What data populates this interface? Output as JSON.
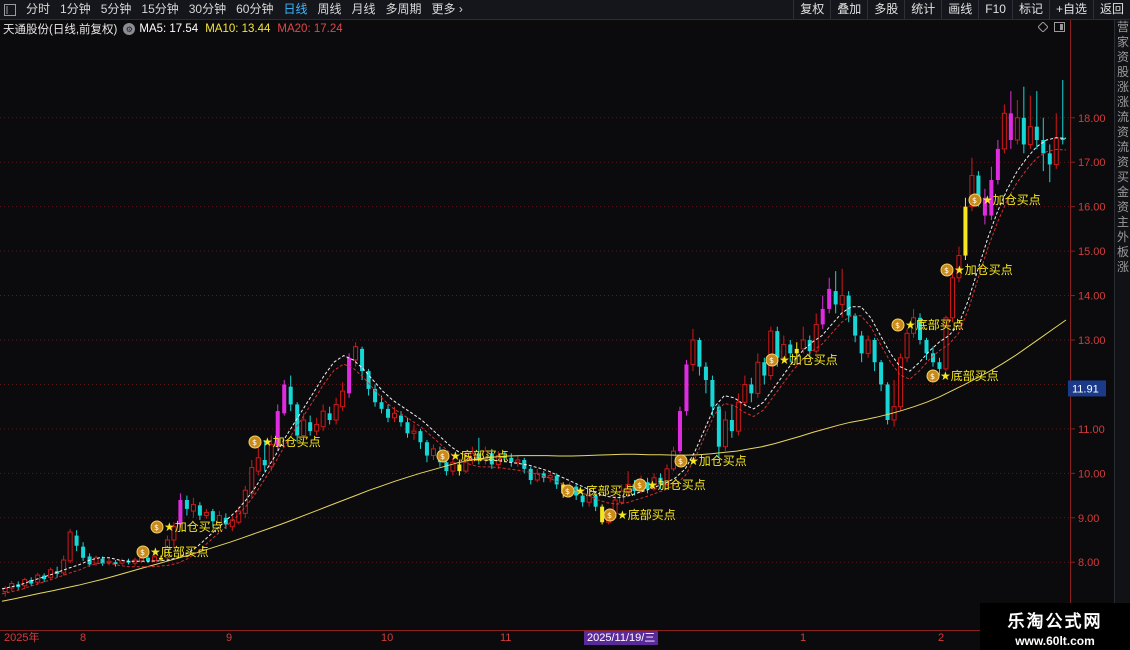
{
  "toolbar": {
    "menu_icon": "menu-icon",
    "periods": [
      "分时",
      "1分钟",
      "5分钟",
      "15分钟",
      "30分钟",
      "60分钟",
      "日线",
      "周线",
      "月线",
      "多周期",
      "更多"
    ],
    "active_period": "日线",
    "more_chevron": "›",
    "right_buttons": [
      "复权",
      "叠加",
      "多股",
      "统计",
      "画线",
      "F10",
      "标记",
      "+自选",
      "返回"
    ]
  },
  "info": {
    "stock": "天通股份(日线,前复权)",
    "ma5": "MA5: 17.54",
    "ma10": "MA10: 13.44",
    "ma20": "MA20: 17.24",
    "colors": {
      "ma5": "#ffffff",
      "ma10": "#f4e63c",
      "ma20": "#e04848"
    }
  },
  "price_axis": {
    "ticks": [
      "18.00",
      "17.00",
      "16.00",
      "15.00",
      "14.00",
      "13.00",
      "12.00",
      "11.00",
      "10.00",
      "9.00",
      "8.00"
    ],
    "current_price": "11.91"
  },
  "date_axis": {
    "labels": [
      "2025年",
      "8",
      "9",
      "10",
      "11",
      "1",
      "2"
    ],
    "cursor_date": "2025/11/19/三"
  },
  "signals": [
    {
      "text": "底部买点"
    },
    {
      "text": "加仓买点"
    },
    {
      "text": "加仓买点"
    },
    {
      "text": "底部买点"
    },
    {
      "text": "底部买点"
    },
    {
      "text": "底部买点"
    },
    {
      "text": "加仓买点"
    },
    {
      "text": "加仓买点"
    },
    {
      "text": "加仓买点"
    },
    {
      "text": "底部买点"
    },
    {
      "text": "底部买点"
    },
    {
      "text": "加仓买点"
    },
    {
      "text": "加仓买点"
    }
  ],
  "right_strip_text": "营家资股涨涨流资流资买金资主外板涨",
  "watermark": {
    "line1": "乐淘公式网",
    "line2": "www.60lt.com"
  },
  "colors": {
    "up": "#d01818",
    "down": "#17d6d6",
    "magenta": "#e02ce0",
    "yellow": "#f5e61e",
    "signal": "#f5e61e",
    "grid": "#5a1a1a",
    "ma_long": "#e6d860",
    "ma_red": "#d03030",
    "ma_white": "#f0f0f0"
  },
  "chart_data": {
    "type": "candlestick",
    "y_range": [
      7.6,
      19.3
    ],
    "candles": [
      [
        7.34,
        7.41,
        7.23,
        7.46
      ],
      [
        7.42,
        7.52,
        7.35,
        7.58
      ],
      [
        7.5,
        7.44,
        7.38,
        7.57
      ],
      [
        7.47,
        7.61,
        7.4,
        7.65
      ],
      [
        7.6,
        7.52,
        7.46,
        7.66
      ],
      [
        7.55,
        7.71,
        7.49,
        7.76
      ],
      [
        7.7,
        7.62,
        7.55,
        7.75
      ],
      [
        7.66,
        7.83,
        7.6,
        7.88
      ],
      [
        7.8,
        7.74,
        7.66,
        7.9
      ],
      [
        7.76,
        8.05,
        7.7,
        8.15
      ],
      [
        8.03,
        8.68,
        7.98,
        8.75
      ],
      [
        8.6,
        8.37,
        8.25,
        8.72
      ],
      [
        8.35,
        8.1,
        8.03,
        8.45
      ],
      [
        8.13,
        7.95,
        7.9,
        8.2
      ],
      [
        7.98,
        8.1,
        7.92,
        8.15
      ],
      [
        8.08,
        7.97,
        7.92,
        8.13
      ],
      [
        7.99,
        8.02,
        7.93,
        8.08
      ],
      [
        8.0,
        7.96,
        7.9,
        8.05
      ],
      [
        7.98,
        8.03,
        7.94,
        8.08
      ],
      [
        8.03,
        7.99,
        7.95,
        8.08
      ],
      [
        7.98,
        8.05,
        7.92,
        8.1
      ],
      [
        8.03,
        8.09,
        7.98,
        8.13
      ],
      [
        8.1,
        8.03,
        7.98,
        8.15
      ],
      [
        8.04,
        8.12,
        8.0,
        8.16
      ],
      [
        8.1,
        8.06,
        8.02,
        8.15
      ],
      [
        8.1,
        8.5,
        8.05,
        8.6
      ],
      [
        8.5,
        8.8,
        8.35,
        8.9
      ],
      [
        8.85,
        9.4,
        8.78,
        9.55
      ],
      [
        9.4,
        9.2,
        9.05,
        9.5
      ],
      [
        9.15,
        9.3,
        9.0,
        9.45
      ],
      [
        9.28,
        9.05,
        8.95,
        9.35
      ],
      [
        9.05,
        9.12,
        8.98,
        9.2
      ],
      [
        9.15,
        8.92,
        8.8,
        9.2
      ],
      [
        8.9,
        9.05,
        8.85,
        9.15
      ],
      [
        9.0,
        8.85,
        8.75,
        9.1
      ],
      [
        8.8,
        8.95,
        8.7,
        9.05
      ],
      [
        8.9,
        9.15,
        8.85,
        9.25
      ],
      [
        9.1,
        9.62,
        9.0,
        9.72
      ],
      [
        9.55,
        10.13,
        9.45,
        10.3
      ],
      [
        10.05,
        10.35,
        9.95,
        10.6
      ],
      [
        10.3,
        10.18,
        10.05,
        10.75
      ],
      [
        10.15,
        10.65,
        10.05,
        10.85
      ],
      [
        10.6,
        11.4,
        10.5,
        11.55
      ],
      [
        11.35,
        12.0,
        11.3,
        12.1
      ],
      [
        11.95,
        11.55,
        11.4,
        12.2
      ],
      [
        11.55,
        10.85,
        10.7,
        11.6
      ],
      [
        10.85,
        11.2,
        10.75,
        11.35
      ],
      [
        11.15,
        10.95,
        10.85,
        11.3
      ],
      [
        10.95,
        11.1,
        10.85,
        11.25
      ],
      [
        11.05,
        11.4,
        10.95,
        11.55
      ],
      [
        11.35,
        11.2,
        11.1,
        11.5
      ],
      [
        11.2,
        11.55,
        11.1,
        11.7
      ],
      [
        11.5,
        11.85,
        11.4,
        12.05
      ],
      [
        11.8,
        12.6,
        11.7,
        12.7
      ],
      [
        12.55,
        12.85,
        12.4,
        12.95
      ],
      [
        12.8,
        12.3,
        12.1,
        12.85
      ],
      [
        12.3,
        11.9,
        11.75,
        12.35
      ],
      [
        11.9,
        11.6,
        11.5,
        12.0
      ],
      [
        11.6,
        11.45,
        11.35,
        11.75
      ],
      [
        11.45,
        11.25,
        11.15,
        11.55
      ],
      [
        11.25,
        11.35,
        11.15,
        11.5
      ],
      [
        11.3,
        11.15,
        11.05,
        11.4
      ],
      [
        11.15,
        10.9,
        10.8,
        11.25
      ],
      [
        10.9,
        10.95,
        10.75,
        11.1
      ],
      [
        10.95,
        10.7,
        10.55,
        11.0
      ],
      [
        10.7,
        10.4,
        10.25,
        10.75
      ],
      [
        10.4,
        10.55,
        10.3,
        10.65
      ],
      [
        10.5,
        10.25,
        10.15,
        10.6
      ],
      [
        10.25,
        10.05,
        9.95,
        10.3
      ],
      [
        10.05,
        10.25,
        9.95,
        10.35
      ],
      [
        10.2,
        10.05,
        9.95,
        10.3
      ],
      [
        10.05,
        10.35,
        10.0,
        10.5
      ],
      [
        10.3,
        10.45,
        10.2,
        10.6
      ],
      [
        10.45,
        10.3,
        10.2,
        10.8
      ],
      [
        10.3,
        10.5,
        10.2,
        10.6
      ],
      [
        10.45,
        10.2,
        10.1,
        10.55
      ],
      [
        10.2,
        10.4,
        10.1,
        10.5
      ],
      [
        10.4,
        10.35,
        10.25,
        10.5
      ],
      [
        10.35,
        10.25,
        10.15,
        10.45
      ],
      [
        10.25,
        10.3,
        10.15,
        10.4
      ],
      [
        10.3,
        10.1,
        10.0,
        10.35
      ],
      [
        10.1,
        9.85,
        9.75,
        10.15
      ],
      [
        9.85,
        10.0,
        9.8,
        10.1
      ],
      [
        10.0,
        9.9,
        9.8,
        10.05
      ],
      [
        9.9,
        9.95,
        9.8,
        10.05
      ],
      [
        9.95,
        9.75,
        9.65,
        10.0
      ],
      [
        9.75,
        9.55,
        9.45,
        9.8
      ],
      [
        9.55,
        9.7,
        9.45,
        9.8
      ],
      [
        9.7,
        9.5,
        9.4,
        9.75
      ],
      [
        9.5,
        9.35,
        9.25,
        9.55
      ],
      [
        9.35,
        9.5,
        9.25,
        9.6
      ],
      [
        9.5,
        9.25,
        9.15,
        9.55
      ],
      [
        9.25,
        8.9,
        8.85,
        9.3
      ],
      [
        8.9,
        9.1,
        8.85,
        9.2
      ],
      [
        9.1,
        9.4,
        9.05,
        9.5
      ],
      [
        9.35,
        9.6,
        9.3,
        9.75
      ],
      [
        9.6,
        9.75,
        9.5,
        10.05
      ],
      [
        9.75,
        9.6,
        9.5,
        9.85
      ],
      [
        9.6,
        9.8,
        9.55,
        9.95
      ],
      [
        9.8,
        9.65,
        9.55,
        9.9
      ],
      [
        9.65,
        9.9,
        9.6,
        10.0
      ],
      [
        9.9,
        9.75,
        9.65,
        10.0
      ],
      [
        9.75,
        10.1,
        9.7,
        10.2
      ],
      [
        10.1,
        10.5,
        10.05,
        10.6
      ],
      [
        10.5,
        11.4,
        10.45,
        11.5
      ],
      [
        11.4,
        12.45,
        11.3,
        12.55
      ],
      [
        12.45,
        13.0,
        12.3,
        13.25
      ],
      [
        13.0,
        12.4,
        12.2,
        13.05
      ],
      [
        12.4,
        12.1,
        11.8,
        12.5
      ],
      [
        12.1,
        11.5,
        11.3,
        12.2
      ],
      [
        11.5,
        10.6,
        10.35,
        11.55
      ],
      [
        10.6,
        11.2,
        10.5,
        11.4
      ],
      [
        11.2,
        10.95,
        10.8,
        11.55
      ],
      [
        10.95,
        11.6,
        10.85,
        11.8
      ],
      [
        11.6,
        12.0,
        11.5,
        12.2
      ],
      [
        12.0,
        11.8,
        11.6,
        12.15
      ],
      [
        11.8,
        12.5,
        11.7,
        12.7
      ],
      [
        12.5,
        12.2,
        12.0,
        12.6
      ],
      [
        12.2,
        13.2,
        12.1,
        13.3
      ],
      [
        13.2,
        12.6,
        12.4,
        13.3
      ],
      [
        12.6,
        12.9,
        12.5,
        13.1
      ],
      [
        12.9,
        12.7,
        12.5,
        13.0
      ],
      [
        12.7,
        12.8,
        12.6,
        12.95
      ],
      [
        12.8,
        13.0,
        12.7,
        13.3
      ],
      [
        13.0,
        12.75,
        12.6,
        13.1
      ],
      [
        12.75,
        13.35,
        12.7,
        13.6
      ],
      [
        13.35,
        13.7,
        13.25,
        14.0
      ],
      [
        13.7,
        14.15,
        13.6,
        14.4
      ],
      [
        14.1,
        13.8,
        13.6,
        14.55
      ],
      [
        13.8,
        14.0,
        13.5,
        14.6
      ],
      [
        14.0,
        13.55,
        13.4,
        14.1
      ],
      [
        13.55,
        13.1,
        12.95,
        13.6
      ],
      [
        13.1,
        12.7,
        12.5,
        13.2
      ],
      [
        12.7,
        13.0,
        12.6,
        13.1
      ],
      [
        13.0,
        12.5,
        12.3,
        13.05
      ],
      [
        12.5,
        12.0,
        11.85,
        12.55
      ],
      [
        12.0,
        11.2,
        11.1,
        12.05
      ],
      [
        11.2,
        11.5,
        11.05,
        12.1
      ],
      [
        11.5,
        12.6,
        11.4,
        12.7
      ],
      [
        12.6,
        13.15,
        12.5,
        13.25
      ],
      [
        13.15,
        13.5,
        13.05,
        13.7
      ],
      [
        13.5,
        13.0,
        12.9,
        13.6
      ],
      [
        13.0,
        12.7,
        12.55,
        13.05
      ],
      [
        12.7,
        12.5,
        12.4,
        12.85
      ],
      [
        12.5,
        12.35,
        12.2,
        12.6
      ],
      [
        12.35,
        13.5,
        12.3,
        13.55
      ],
      [
        13.5,
        14.4,
        13.4,
        14.5
      ],
      [
        14.4,
        14.9,
        14.3,
        15.1
      ],
      [
        14.9,
        16.0,
        14.8,
        16.2
      ],
      [
        16.0,
        16.7,
        15.9,
        17.1
      ],
      [
        16.7,
        16.2,
        16.0,
        16.8
      ],
      [
        16.2,
        15.8,
        15.6,
        16.4
      ],
      [
        15.8,
        16.6,
        15.7,
        16.9
      ],
      [
        16.6,
        17.3,
        16.5,
        17.5
      ],
      [
        17.3,
        18.1,
        17.2,
        18.3
      ],
      [
        18.1,
        17.5,
        17.3,
        18.6
      ],
      [
        17.5,
        18.0,
        17.4,
        18.4
      ],
      [
        18.0,
        17.4,
        17.2,
        18.7
      ],
      [
        17.4,
        17.8,
        17.3,
        18.5
      ],
      [
        17.8,
        17.5,
        17.3,
        18.6
      ],
      [
        17.5,
        17.2,
        16.8,
        18.0
      ],
      [
        17.2,
        16.95,
        16.55,
        17.4
      ],
      [
        16.95,
        17.55,
        16.85,
        18.1
      ],
      [
        17.55,
        17.5,
        17.4,
        18.85
      ]
    ],
    "ma5": [
      7.4,
      7.45,
      7.5,
      7.58,
      7.65,
      7.72,
      7.8,
      7.88,
      7.95,
      8.05,
      8.1,
      8.1,
      8.05,
      8.02,
      8.02,
      8.02,
      8.03,
      8.05,
      8.1,
      8.2,
      8.35,
      8.55,
      8.75,
      8.95,
      9.15,
      9.4,
      9.7,
      10.05,
      10.4,
      10.8,
      11.15,
      11.5,
      11.85,
      12.2,
      12.5,
      12.65,
      12.55,
      12.35,
      12.1,
      11.85,
      11.65,
      11.5,
      11.35,
      11.2,
      11.0,
      10.8,
      10.6,
      10.45,
      10.35,
      10.3,
      10.3,
      10.28,
      10.25,
      10.22,
      10.18,
      10.12,
      10.05,
      9.95,
      9.85,
      9.75,
      9.65,
      9.55,
      9.48,
      9.45,
      9.48,
      9.55,
      9.62,
      9.7,
      9.78,
      9.9,
      10.1,
      10.5,
      11.0,
      11.5,
      11.75,
      11.7,
      11.55,
      11.45,
      11.6,
      11.9,
      12.2,
      12.5,
      12.75,
      12.95,
      13.1,
      13.35,
      13.6,
      13.75,
      13.75,
      13.5,
      13.1,
      12.7,
      12.4,
      12.3,
      12.5,
      12.75,
      12.95,
      13.1,
      13.35,
      13.9,
      14.6,
      15.3,
      15.9,
      16.4,
      16.8,
      17.1,
      17.35,
      17.5,
      17.55,
      17.54
    ],
    "ma_long": [
      7.12,
      7.18,
      7.24,
      7.3,
      7.36,
      7.42,
      7.48,
      7.55,
      7.62,
      7.7,
      7.78,
      7.86,
      7.94,
      8.02,
      8.1,
      8.18,
      8.27,
      8.36,
      8.45,
      8.55,
      8.65,
      8.75,
      8.85,
      8.96,
      9.07,
      9.18,
      9.29,
      9.4,
      9.51,
      9.62,
      9.72,
      9.82,
      9.91,
      10.0,
      10.08,
      10.16,
      10.24,
      10.3,
      10.34,
      10.37,
      10.39,
      10.4,
      10.4,
      10.4,
      10.39,
      10.39,
      10.4,
      10.41,
      10.42,
      10.43,
      10.43,
      10.42,
      10.42,
      10.41,
      10.41,
      10.42,
      10.44,
      10.47,
      10.5,
      10.55,
      10.6,
      10.67,
      10.75,
      10.83,
      10.92,
      11.0,
      11.08,
      11.15,
      11.2,
      11.26,
      11.33,
      11.41,
      11.5,
      11.6,
      11.72,
      11.86,
      12.0,
      12.15,
      12.3,
      12.47,
      12.65,
      12.85,
      13.05,
      13.25,
      13.45
    ]
  }
}
